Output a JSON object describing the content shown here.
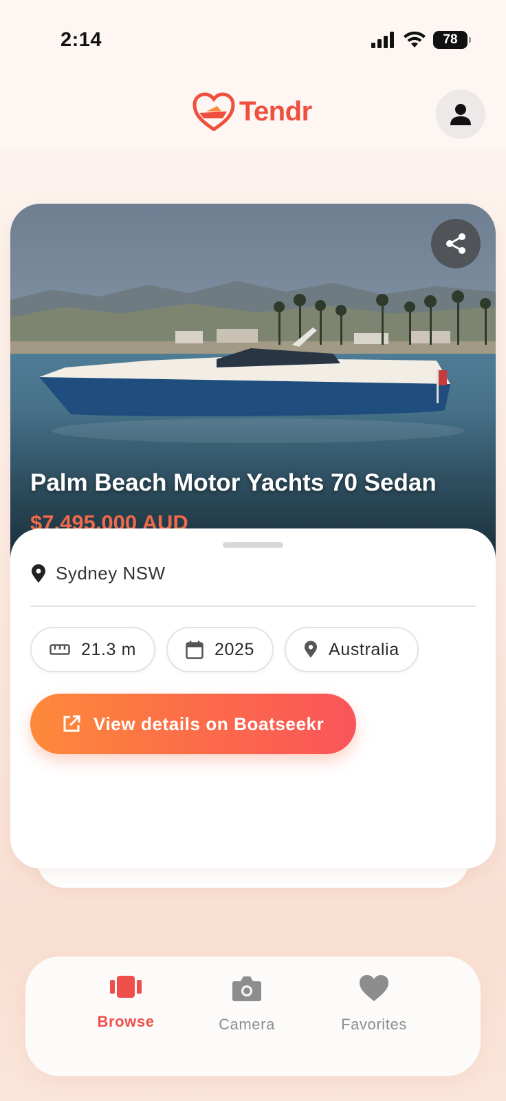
{
  "status_bar": {
    "time": "2:14",
    "battery": "78"
  },
  "header": {
    "app_name": "Tendr"
  },
  "listing": {
    "title": "Palm Beach Motor Yachts 70 Sedan",
    "price": "$7,495,000 AUD",
    "location": "Sydney NSW",
    "chips": {
      "length": "21.3 m",
      "year": "2025",
      "country": "Australia"
    },
    "cta_label": "View details on Boatseekr"
  },
  "nav": {
    "items": [
      {
        "label": "Browse",
        "icon": "cards-icon",
        "active": true
      },
      {
        "label": "Camera",
        "icon": "camera-icon",
        "active": false
      },
      {
        "label": "Favorites",
        "icon": "heart-icon",
        "active": false
      }
    ]
  },
  "colors": {
    "accent": "#ef4f4a",
    "cta_start": "#fd8a3a",
    "cta_end": "#f9555a",
    "inactive": "#8d8d8d"
  }
}
